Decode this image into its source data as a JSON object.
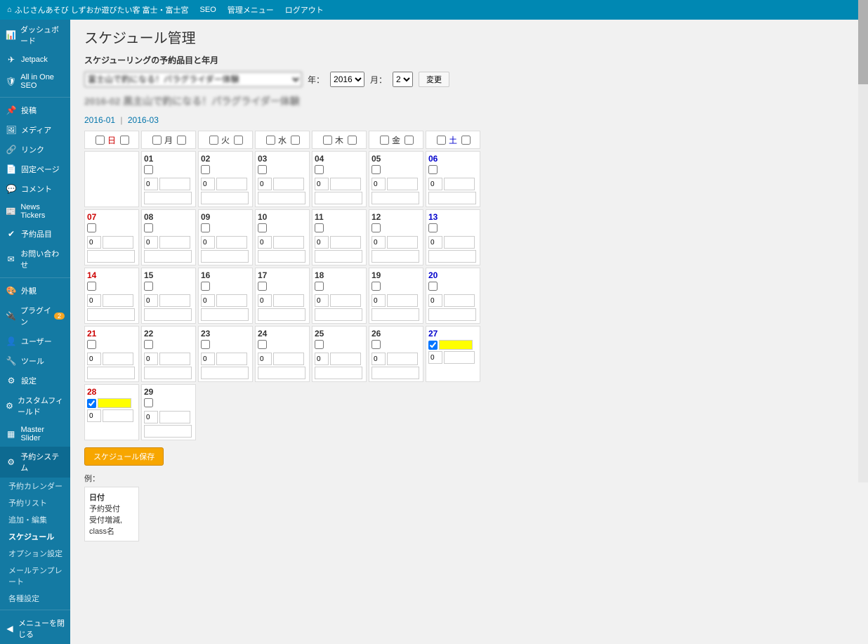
{
  "topbar": {
    "site": "ふじさんあそび しずおか遊びたい客 富士・富士宮",
    "seo": "SEO",
    "admin_menu": "管理メニュー",
    "logout": "ログアウト"
  },
  "sidebar": {
    "items": [
      {
        "icon": "📊",
        "label": "ダッシュボード"
      },
      {
        "icon": "✈",
        "label": "Jetpack"
      },
      {
        "icon": "🛡",
        "label": "All in One SEO"
      },
      {
        "icon": "📌",
        "label": "投稿"
      },
      {
        "icon": "🖼",
        "label": "メディア"
      },
      {
        "icon": "🔗",
        "label": "リンク"
      },
      {
        "icon": "📄",
        "label": "固定ページ"
      },
      {
        "icon": "💬",
        "label": "コメント"
      },
      {
        "icon": "📰",
        "label": "News Tickers"
      },
      {
        "icon": "✔",
        "label": "予約品目"
      },
      {
        "icon": "✉",
        "label": "お問い合わせ"
      },
      {
        "icon": "🎨",
        "label": "外観"
      },
      {
        "icon": "🔌",
        "label": "プラグイン",
        "badge": "2"
      },
      {
        "icon": "👤",
        "label": "ユーザー"
      },
      {
        "icon": "🔧",
        "label": "ツール"
      },
      {
        "icon": "⚙",
        "label": "設定"
      },
      {
        "icon": "⚙",
        "label": "カスタムフィールド"
      },
      {
        "icon": "▦",
        "label": "Master Slider"
      },
      {
        "icon": "⚙",
        "label": "予約システム",
        "active": true
      }
    ],
    "subs": [
      {
        "label": "予約カレンダー"
      },
      {
        "label": "予約リスト"
      },
      {
        "label": "追加・編集"
      },
      {
        "label": "スケジュール",
        "active": true
      },
      {
        "label": "オプション設定"
      },
      {
        "label": "メールテンプレート"
      },
      {
        "label": "各種設定"
      }
    ],
    "collapse": {
      "icon": "◀",
      "label": "メニューを閉じる"
    }
  },
  "page": {
    "title": "スケジュール管理",
    "section_label": "スケジューリングの予約品目と年月",
    "year_label": "年：",
    "month_label": "月：",
    "year_value": "2016",
    "month_value": "2",
    "change_btn": "変更",
    "subtitle": "2016-02 黒主山で釣になる！パラグライダー体験",
    "prev_link": "2016-01",
    "next_link": "2016-03",
    "save_btn": "スケジュール保存",
    "example_label": "例：",
    "example_date": "日付",
    "example_line1": "予約受付",
    "example_line2": "受付増減, class名"
  },
  "days": [
    "日",
    "月",
    "火",
    "水",
    "木",
    "金",
    "土"
  ],
  "calendar": {
    "blanks": 1,
    "last": 29,
    "checked": [
      27,
      28
    ]
  }
}
